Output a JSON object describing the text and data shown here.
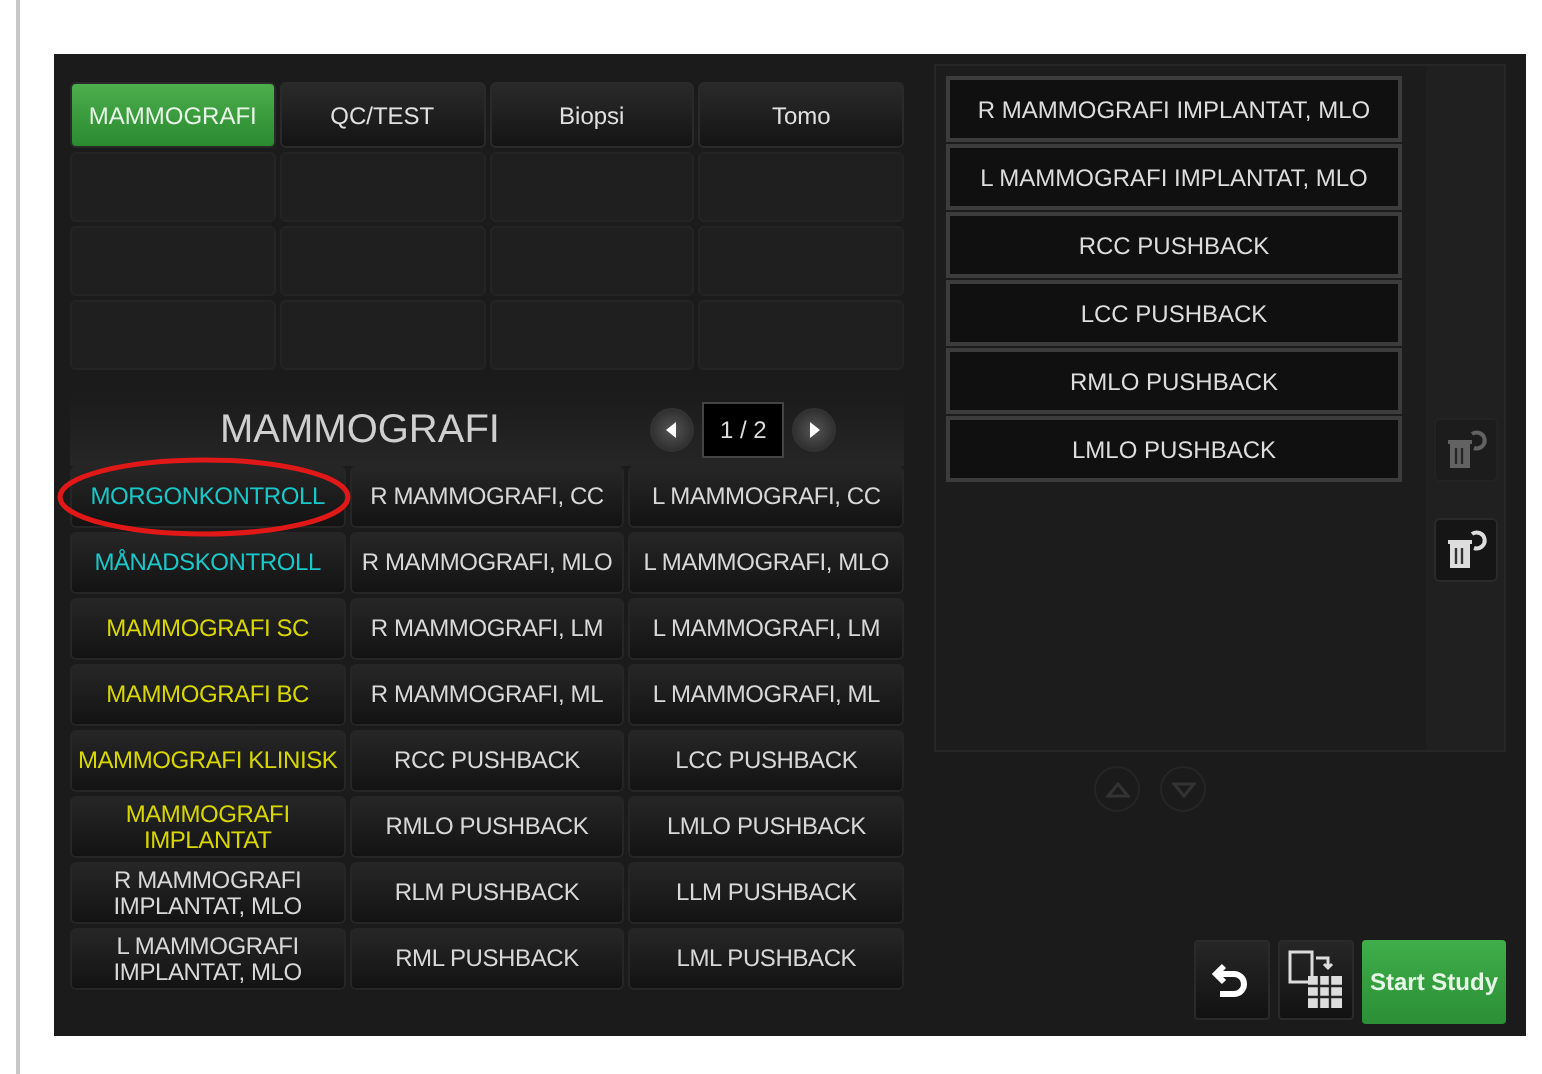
{
  "tabs": [
    {
      "label": "MAMMOGRAFI",
      "selected": true
    },
    {
      "label": "QC/TEST",
      "selected": false
    },
    {
      "label": "Biopsi",
      "selected": false
    },
    {
      "label": "Tomo",
      "selected": false
    }
  ],
  "section_title": "MAMMOGRAFI",
  "pager": {
    "page": "1 / 2"
  },
  "protocols": [
    {
      "label": "MORGONKONTROLL",
      "color": "#19c8c8",
      "circled": true
    },
    {
      "label": "R MAMMOGRAFI, CC",
      "color": "#d8d8d8",
      "circled": false
    },
    {
      "label": "L MAMMOGRAFI, CC",
      "color": "#d8d8d8",
      "circled": false
    },
    {
      "label": "MÅNADSKONTROLL",
      "color": "#19c8c8",
      "circled": false
    },
    {
      "label": "R MAMMOGRAFI, MLO",
      "color": "#d8d8d8",
      "circled": false
    },
    {
      "label": "L MAMMOGRAFI, MLO",
      "color": "#d8d8d8",
      "circled": false
    },
    {
      "label": "MAMMOGRAFI SC",
      "color": "#d8d800",
      "circled": false
    },
    {
      "label": "R MAMMOGRAFI, LM",
      "color": "#d8d8d8",
      "circled": false
    },
    {
      "label": "L MAMMOGRAFI, LM",
      "color": "#d8d8d8",
      "circled": false
    },
    {
      "label": "MAMMOGRAFI BC",
      "color": "#d8d800",
      "circled": false
    },
    {
      "label": "R MAMMOGRAFI, ML",
      "color": "#d8d8d8",
      "circled": false
    },
    {
      "label": "L MAMMOGRAFI, ML",
      "color": "#d8d8d8",
      "circled": false
    },
    {
      "label": "MAMMOGRAFI KLINISK",
      "color": "#d8d800",
      "circled": false
    },
    {
      "label": "RCC PUSHBACK",
      "color": "#d8d8d8",
      "circled": false
    },
    {
      "label": "LCC PUSHBACK",
      "color": "#d8d8d8",
      "circled": false
    },
    {
      "label": "MAMMOGRAFI IMPLANTAT",
      "color": "#d8d800",
      "circled": false
    },
    {
      "label": "RMLO PUSHBACK",
      "color": "#d8d8d8",
      "circled": false
    },
    {
      "label": "LMLO PUSHBACK",
      "color": "#d8d8d8",
      "circled": false
    },
    {
      "label": "R MAMMOGRAFI IMPLANTAT, MLO",
      "color": "#d8d8d8",
      "circled": false
    },
    {
      "label": "RLM PUSHBACK",
      "color": "#d8d8d8",
      "circled": false
    },
    {
      "label": "LLM PUSHBACK",
      "color": "#d8d8d8",
      "circled": false
    },
    {
      "label": "L MAMMOGRAFI IMPLANTAT, MLO",
      "color": "#d8d8d8",
      "circled": false
    },
    {
      "label": "RML PUSHBACK",
      "color": "#d8d8d8",
      "circled": false
    },
    {
      "label": "LML PUSHBACK",
      "color": "#d8d8d8",
      "circled": false
    }
  ],
  "selected_views": [
    "R MAMMOGRAFI IMPLANTAT, MLO",
    "L MAMMOGRAFI IMPLANTAT, MLO",
    "RCC PUSHBACK",
    "LCC PUSHBACK",
    "RMLO PUSHBACK",
    "LMLO PUSHBACK"
  ],
  "side_tools": [
    {
      "disabled": true
    },
    {
      "disabled": false
    }
  ],
  "scroll_buttons": {
    "disabled": true
  },
  "start_button": "Start Study"
}
